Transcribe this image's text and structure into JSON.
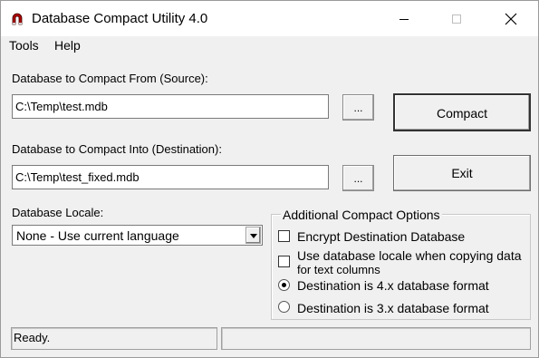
{
  "window": {
    "title": "Database Compact Utility 4.0",
    "icon": "magnet-icon",
    "controls": [
      "minimize-icon",
      "maximize-icon",
      "close-icon"
    ]
  },
  "menu": {
    "tools": "Tools",
    "help": "Help"
  },
  "source": {
    "label": "Database to Compact From (Source):",
    "value": "C:\\Temp\\test.mdb",
    "browse_label": "..."
  },
  "destination": {
    "label": "Database to Compact Into (Destination):",
    "value": "C:\\Temp\\test_fixed.mdb",
    "browse_label": "..."
  },
  "buttons": {
    "compact": "Compact",
    "exit": "Exit"
  },
  "locale": {
    "label": "Database Locale:",
    "selected": "None - Use current language"
  },
  "options": {
    "title": "Additional Compact Options",
    "encrypt": {
      "label": "Encrypt Destination Database",
      "checked": false
    },
    "use_locale": {
      "line1": "Use database locale when copying data",
      "line2": "for text columns",
      "checked": false
    },
    "format4x": {
      "label": "Destination is 4.x database format",
      "selected": true
    },
    "format3x": {
      "label": "Destination is 3.x database format",
      "selected": false
    }
  },
  "status": {
    "text": "Ready.",
    "secondary": ""
  },
  "colors": {
    "accent": "#c00000",
    "face": "#f0f0f0",
    "titlebar": "#ffffff"
  }
}
